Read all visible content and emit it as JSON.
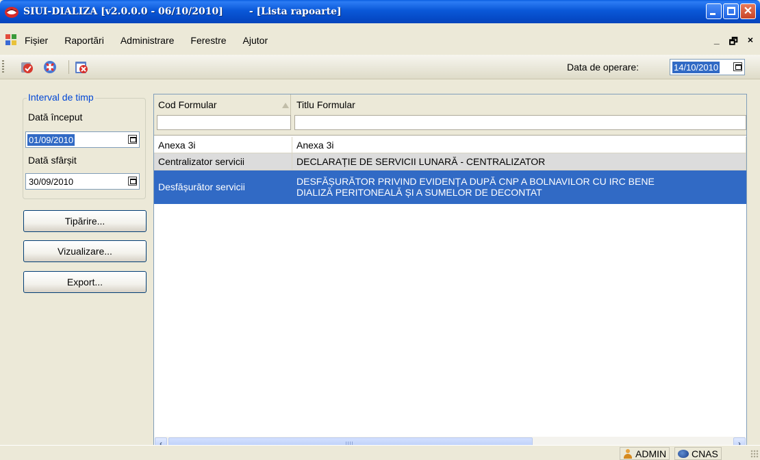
{
  "window": {
    "title": "SIUI-DIALIZA [v2.0.0.0 - 06/10/2010]",
    "subtitle": "- [Lista rapoarte]"
  },
  "menu": {
    "items": [
      {
        "label": "Fișier",
        "underline": "F"
      },
      {
        "label": "Raportări",
        "underline": "R"
      },
      {
        "label": "Administrare",
        "underline": "A"
      },
      {
        "label": "Ferestre",
        "underline": "e"
      },
      {
        "label": "Ajutor",
        "underline": "j"
      }
    ],
    "mdi": {
      "minimize": "_",
      "restore": "🗗",
      "close": "×"
    }
  },
  "toolbar": {
    "icons": [
      "report-icon",
      "refresh-icon",
      "close-window-icon"
    ],
    "operation_date_label": "Data de operare:",
    "operation_date_value": "14/10/2010"
  },
  "filters": {
    "group_title": "Interval de timp",
    "start_label": "Dată început",
    "start_value": "01/09/2010",
    "end_label": "Dată sfârșit",
    "end_value": "30/09/2010"
  },
  "buttons": {
    "print": "Tipărire...",
    "view": "Vizualizare...",
    "export": "Export..."
  },
  "grid": {
    "columns": [
      "Cod Formular",
      "Titlu Formular"
    ],
    "rows": [
      {
        "code": "Anexa 3i",
        "title": [
          "Anexa 3i"
        ]
      },
      {
        "code": "Centralizator servicii",
        "title": [
          "DECLARAȚIE DE SERVICII LUNARĂ - CENTRALIZATOR"
        ]
      },
      {
        "code": "Desfășurător servicii",
        "title": [
          "DESFĂȘURĂTOR PRIVIND EVIDENȚA DUPĂ CNP A BOLNAVILOR CU IRC BENE",
          "DIALIZĂ PERITONEALĂ ȘI A SUMELOR DE DECONTAT"
        ]
      }
    ],
    "selected_row": 2
  },
  "status": {
    "user": "ADMIN",
    "org": "CNAS"
  },
  "colors": {
    "titlebar": "#0a58d8",
    "selection": "#316ac5",
    "group_title": "#0046d5"
  }
}
